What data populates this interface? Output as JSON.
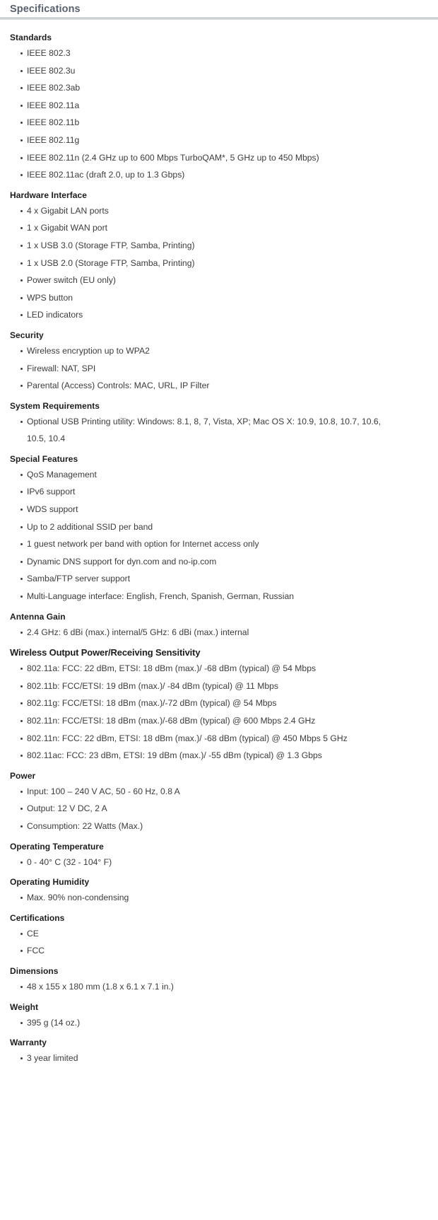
{
  "page": {
    "title": "Specifications"
  },
  "groups": [
    {
      "heading": "Standards",
      "items": [
        "IEEE 802.3",
        "IEEE 802.3u",
        "IEEE 802.3ab",
        "IEEE 802.11a",
        "IEEE 802.11b",
        "IEEE 802.11g",
        "IEEE 802.11n (2.4 GHz up to 600 Mbps TurboQAM*, 5 GHz up to 450 Mbps)",
        "IEEE 802.11ac (draft 2.0, up to 1.3 Gbps)"
      ]
    },
    {
      "heading": "Hardware Interface",
      "items": [
        "4 x Gigabit LAN ports",
        "1 x Gigabit WAN port",
        "1 x USB 3.0 (Storage FTP, Samba, Printing)",
        "1 x USB 2.0 (Storage FTP, Samba, Printing)",
        "Power switch (EU only)",
        "WPS button",
        "LED indicators"
      ]
    },
    {
      "heading": "Security",
      "items": [
        "Wireless encryption up to WPA2",
        "Firewall: NAT, SPI",
        "Parental (Access) Controls: MAC, URL, IP Filter"
      ]
    },
    {
      "heading": "System Requirements",
      "items": [
        "Optional USB Printing utility: Windows: 8.1, 8, 7, Vista, XP; Mac OS X: 10.9, 10.8, 10.7, 10.6, 10.5, 10.4"
      ]
    },
    {
      "heading": "Special Features",
      "items": [
        "QoS Management",
        "IPv6 support",
        "WDS support",
        "Up to 2 additional SSID per band",
        "1 guest network per band with option for Internet access only",
        "Dynamic DNS support for dyn.com and no-ip.com",
        "Samba/FTP server support",
        "Multi-Language interface: English, French, Spanish, German, Russian"
      ]
    },
    {
      "heading": "Antenna Gain",
      "items": [
        "2.4 GHz: 6 dBi (max.) internal/5 GHz: 6 dBi (max.) internal"
      ]
    },
    {
      "heading": "Wireless Output Power/Receiving Sensitivity",
      "heading_style": "wide",
      "items": [
        "802.11a: FCC: 22 dBm, ETSI: 18 dBm (max.)/ -68 dBm (typical) @ 54 Mbps",
        "802.11b: FCC/ETSI: 19 dBm (max.)/ -84 dBm (typical) @ 11 Mbps",
        "802.11g: FCC/ETSI: 18 dBm (max.)/-72 dBm (typical) @ 54 Mbps",
        "802.11n: FCC/ETSI: 18 dBm (max.)/-68 dBm (typical) @ 600 Mbps 2.4 GHz",
        "802.11n: FCC: 22 dBm, ETSI: 18 dBm (max.)/ -68 dBm (typical) @ 450 Mbps 5 GHz",
        "802.11ac: FCC: 23 dBm, ETSI: 19 dBm (max.)/ -55 dBm (typical) @ 1.3 Gbps"
      ]
    },
    {
      "heading": "Power",
      "items": [
        "Input: 100 – 240 V AC, 50 - 60 Hz, 0.8 A",
        "Output: 12 V DC, 2 A",
        "Consumption: 22 Watts (Max.)"
      ]
    },
    {
      "heading": "Operating Temperature",
      "items": [
        "0 - 40° C (32 - 104° F)"
      ]
    },
    {
      "heading": "Operating Humidity",
      "items": [
        "Max. 90% non-condensing"
      ]
    },
    {
      "heading": "Certifications",
      "items": [
        "CE",
        "FCC"
      ]
    },
    {
      "heading": "Dimensions",
      "items": [
        "48 x 155 x 180 mm (1.8 x 6.1 x 7.1 in.)"
      ]
    },
    {
      "heading": "Weight",
      "items": [
        "395 g (14 oz.)"
      ]
    },
    {
      "heading": "Warranty",
      "items": [
        "3 year limited"
      ]
    }
  ],
  "colors": {
    "title": "#58626f",
    "rule_top": "#8d95a0",
    "rule_bottom": "#cfd4da",
    "heading": "#1d1d1d",
    "body_text": "#3c3c3c",
    "background": "#ffffff"
  }
}
